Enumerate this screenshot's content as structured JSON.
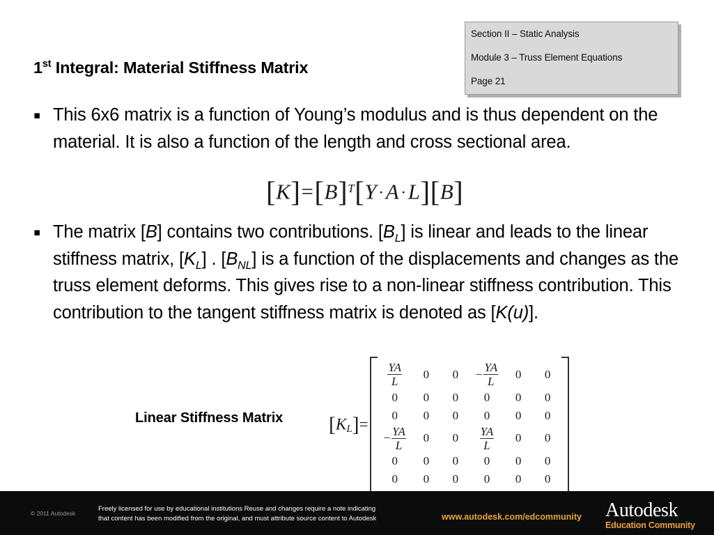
{
  "slide": {
    "title_main": "Integral: Material Stiffness Matrix",
    "title_number": "1",
    "title_ordinal": "st"
  },
  "header_box": {
    "line1": "Section II – Static Analysis",
    "line2": "Module 3 – Truss Element Equations",
    "line3": "Page 21"
  },
  "bullets": [
    {
      "marker": "▪",
      "text": "This 6x6 matrix is a function of Young’s modulus and is thus dependent on the material.  It is also a function of the length and cross sectional area."
    },
    {
      "marker": "▪",
      "part1": "The matrix [",
      "var_b": "B",
      "part2": "] contains two contributions. [",
      "var_bl": "B",
      "sub_bl": "L",
      "part3": "] is linear and leads to the linear stiffness matrix, [",
      "var_kl": "K",
      "sub_kl": "L",
      "part4": "] . [",
      "var_bnl": "B",
      "sub_bnl": "NL",
      "part5": "] is a function of the displacements and changes as the truss element deforms.  This gives rise to a non-linear stiffness contribution.  This contribution to the tangent stiffness matrix is denoted as [",
      "var_ku": "K(u)",
      "part6": "]."
    }
  ],
  "equation_main": {
    "lhs_open": "[",
    "lhs_var": "K",
    "lhs_close": "]",
    "equals": "=",
    "b_open": "[",
    "b_var": "B",
    "b_close": "]",
    "b_exp": "T",
    "yal_open": "[",
    "y": "Y",
    "dot1": "·",
    "a": "A",
    "dot2": "·",
    "l": "L",
    "yal_close": "]",
    "b2_open": "[",
    "b2_var": "B",
    "b2_close": "]"
  },
  "matrix_section": {
    "label": "Linear Stiffness Matrix",
    "lhs_open": "[",
    "lhs_var": "K",
    "lhs_sub": "L",
    "lhs_close": "]",
    "lhs_equals": "=",
    "fraction": {
      "numerator": "YA",
      "denominator": "L"
    },
    "minus": "−",
    "zero": "0",
    "rows": [
      [
        "+YA/L",
        "0",
        "0",
        "-YA/L",
        "0",
        "0"
      ],
      [
        "0",
        "0",
        "0",
        "0",
        "0",
        "0"
      ],
      [
        "0",
        "0",
        "0",
        "0",
        "0",
        "0"
      ],
      [
        "-YA/L",
        "0",
        "0",
        "+YA/L",
        "0",
        "0"
      ],
      [
        "0",
        "0",
        "0",
        "0",
        "0",
        "0"
      ],
      [
        "0",
        "0",
        "0",
        "0",
        "0",
        "0"
      ]
    ]
  },
  "footer": {
    "copyright": "© 2011 Autodesk",
    "license_line1": "Freely licensed for use by educational institutions  Reuse and changes require a note indicating",
    "license_line2": "that content has been modified from the original, and must attribute source content to Autodesk",
    "url": "www.autodesk.com/edcommunity",
    "logo_main": "Autodesk",
    "logo_sub": "Education Community",
    "colors": {
      "background": "#0d0c0c",
      "accent": "#e8a33d",
      "text": "#ffffff"
    }
  }
}
